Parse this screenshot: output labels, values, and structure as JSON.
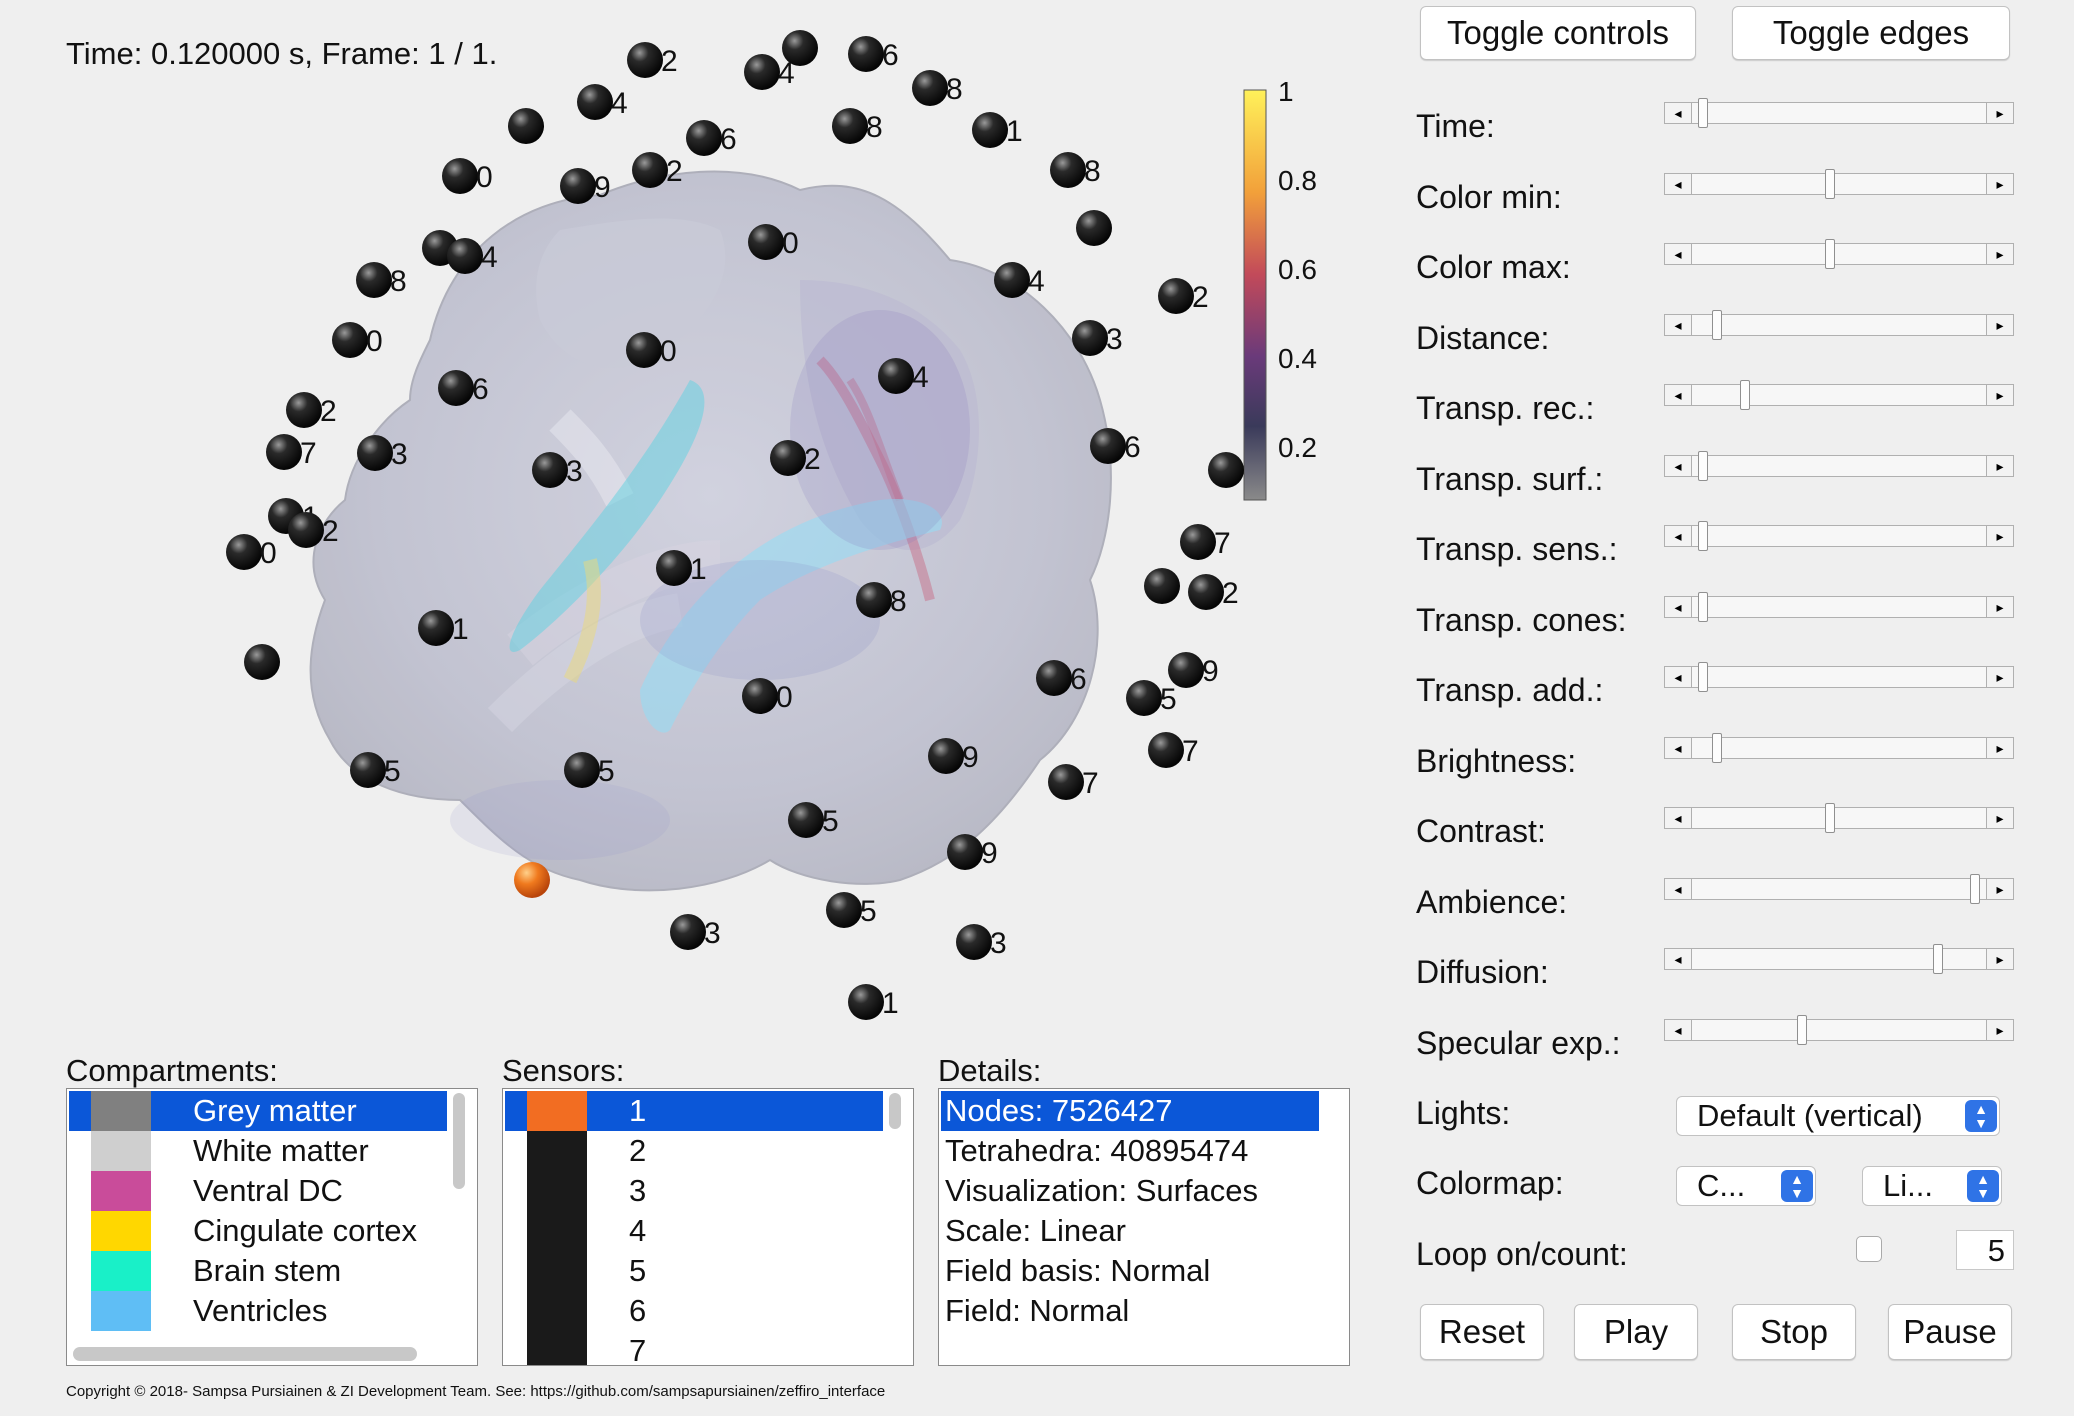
{
  "viewer": {
    "time_label": "Time: 0.120000 s, Frame: 1 / 1.",
    "colorbar": {
      "ticks": [
        "1",
        "0.8",
        "0.6",
        "0.4",
        "0.2"
      ],
      "colors": [
        "#fff15a",
        "#f2a03a",
        "#c24a5a",
        "#6a3a7a",
        "#3a3a5a",
        "#8a8a8a"
      ]
    },
    "sensor_labels": [
      "2",
      "4",
      "6",
      "8",
      "4",
      "6",
      "8",
      "1",
      "0",
      "9",
      "2",
      "8",
      "6",
      "4",
      "0",
      "4",
      "8",
      "2",
      "0",
      "0",
      "6",
      "3",
      "4",
      "2",
      "7",
      "3",
      "6",
      "2",
      "3",
      "1",
      "2",
      "0",
      "7",
      "1",
      "8",
      "2",
      "1",
      "6",
      "9",
      "5",
      "0",
      "7",
      "5",
      "5",
      "9",
      "7",
      "5",
      "9",
      "3",
      "5",
      "3",
      "1",
      "1",
      "4",
      "3"
    ]
  },
  "buttons": {
    "toggle_controls": "Toggle controls",
    "toggle_edges": "Toggle edges",
    "reset": "Reset",
    "play": "Play",
    "stop": "Stop",
    "pause": "Pause"
  },
  "controls": [
    {
      "label": "Time:",
      "value": 0.02
    },
    {
      "label": "Color min:",
      "value": 0.47
    },
    {
      "label": "Color max:",
      "value": 0.47
    },
    {
      "label": "Distance:",
      "value": 0.07
    },
    {
      "label": "Transp. rec.:",
      "value": 0.17
    },
    {
      "label": "Transp. surf.:",
      "value": 0.02
    },
    {
      "label": "Transp. sens.:",
      "value": 0.02
    },
    {
      "label": "Transp. cones:",
      "value": 0.02
    },
    {
      "label": "Transp. add.:",
      "value": 0.02
    },
    {
      "label": "Brightness:",
      "value": 0.07
    },
    {
      "label": "Contrast:",
      "value": 0.47
    },
    {
      "label": "Ambience:",
      "value": 0.98
    },
    {
      "label": "Diffusion:",
      "value": 0.85
    },
    {
      "label": "Specular exp.:",
      "value": 0.37
    }
  ],
  "lights": {
    "label": "Lights:",
    "value": "Default (vertical)"
  },
  "colormap": {
    "label": "Colormap:",
    "value1": "C...",
    "value2": "Li..."
  },
  "loop": {
    "label": "Loop on/count:",
    "count": "5"
  },
  "compartments": {
    "title": "Compartments:",
    "items": [
      {
        "label": "Grey matter",
        "color": "#808080",
        "selected": true
      },
      {
        "label": "White matter",
        "color": "#cfcfcf",
        "selected": false
      },
      {
        "label": "Ventral DC",
        "color": "#c94c9a",
        "selected": false
      },
      {
        "label": "Cingulate cortex",
        "color": "#ffd700",
        "selected": false
      },
      {
        "label": "Brain stem",
        "color": "#19f0c8",
        "selected": false
      },
      {
        "label": "Ventricles",
        "color": "#5fbef5",
        "selected": false
      }
    ]
  },
  "sensors": {
    "title": "Sensors:",
    "items": [
      "1",
      "2",
      "3",
      "4",
      "5",
      "6",
      "7"
    ],
    "selected_color": "#f26d22",
    "color": "#1a1a1a"
  },
  "details": {
    "title": "Details:",
    "items": [
      "Nodes: 7526427",
      "Tetrahedra: 40895474",
      "Visualization: Surfaces",
      "Scale: Linear",
      "Field basis: Normal",
      "Field: Normal"
    ]
  },
  "copyright": "Copyright © 2018- Sampsa Pursiainen & ZI Development Team. See: https://github.com/sampsapursiainen/zeffiro_interface"
}
